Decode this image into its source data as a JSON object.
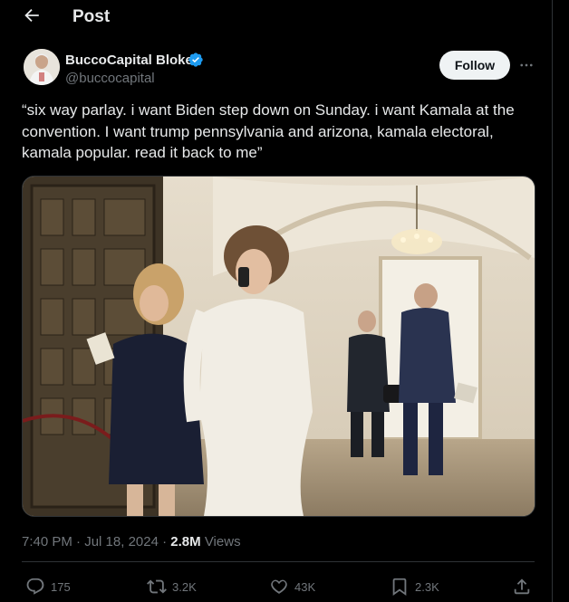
{
  "header": {
    "title": "Post"
  },
  "author": {
    "name": "BuccoCapital Bloke",
    "handle": "@buccocapital",
    "verified": true
  },
  "follow_label": "Follow",
  "post": {
    "text": "“six way parlay. i want Biden step down on Sunday. i want Kamala at the convention. I want trump pennsylvania and arizona, kamala electoral, kamala popular. read it back to me”"
  },
  "meta": {
    "time": "7:40 PM",
    "separator1": " · ",
    "date": "Jul 18, 2024",
    "separator2": " · ",
    "views_count": "2.8M",
    "views_label": " Views"
  },
  "actions": {
    "replies": "175",
    "reposts": "3.2K",
    "likes": "43K",
    "bookmarks": "2.3K"
  },
  "colors": {
    "background": "#000000",
    "text": "#e7e9ea",
    "muted": "#71767b",
    "verified_blue": "#1d9bf0",
    "follow_bg": "#eff3f4"
  }
}
